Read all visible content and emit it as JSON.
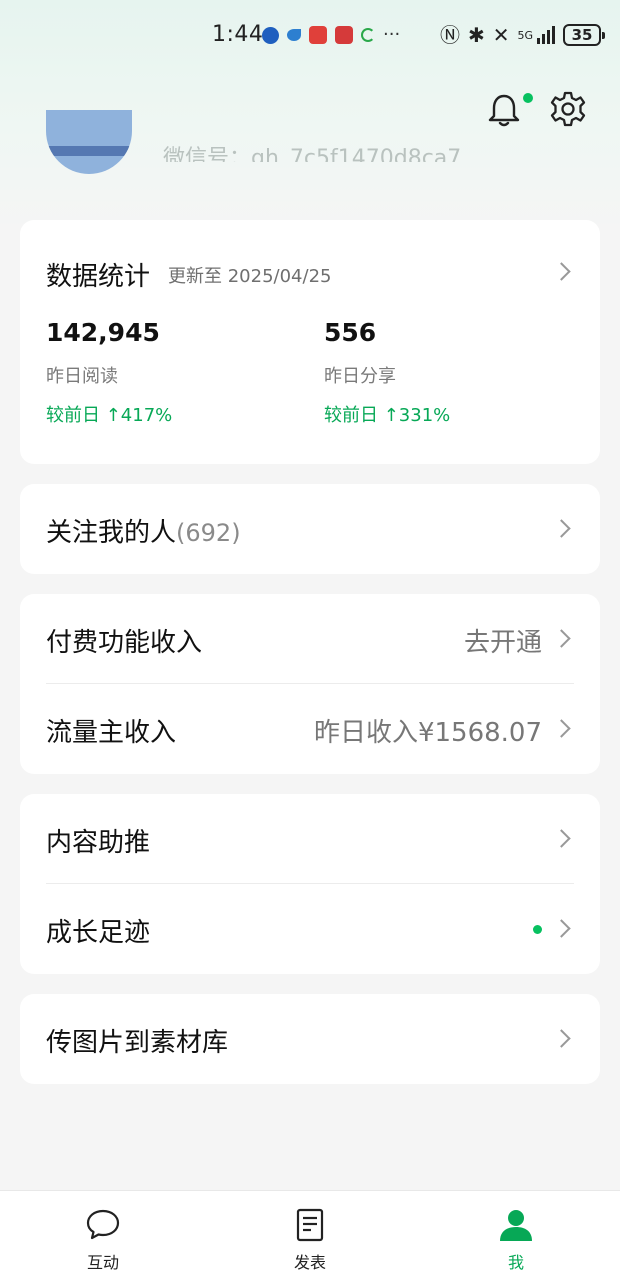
{
  "status_bar": {
    "time": "1:44",
    "network": "5G",
    "battery": "35"
  },
  "header": {
    "bell_has_badge": true,
    "wechat_id": "微信号：gh_7c5f1470d8ca7"
  },
  "stats": {
    "title": "数据统计",
    "updated": "更新至 2025/04/25",
    "items": [
      {
        "value": "142,945",
        "label": "昨日阅读",
        "change": "较前日 ↑417%"
      },
      {
        "value": "556",
        "label": "昨日分享",
        "change": "较前日 ↑331%"
      }
    ]
  },
  "followers": {
    "label": "关注我的人",
    "count": "(692)"
  },
  "income": {
    "paid_label": "付费功能收入",
    "paid_value": "去开通",
    "traffic_label": "流量主收入",
    "traffic_value": "昨日收入¥1568.07"
  },
  "tools": {
    "promote_label": "内容助推",
    "growth_label": "成长足迹"
  },
  "upload": {
    "label": "传图片到素材库"
  },
  "bottom_nav": {
    "items": [
      {
        "label": "互动",
        "icon": "chat-bubble-icon",
        "active": false
      },
      {
        "label": "发表",
        "icon": "document-icon",
        "active": false
      },
      {
        "label": "我",
        "icon": "person-icon",
        "active": true
      }
    ]
  },
  "colors": {
    "accent": "#07c160",
    "accent_text": "#07a856",
    "background": "#f5f5f5"
  }
}
